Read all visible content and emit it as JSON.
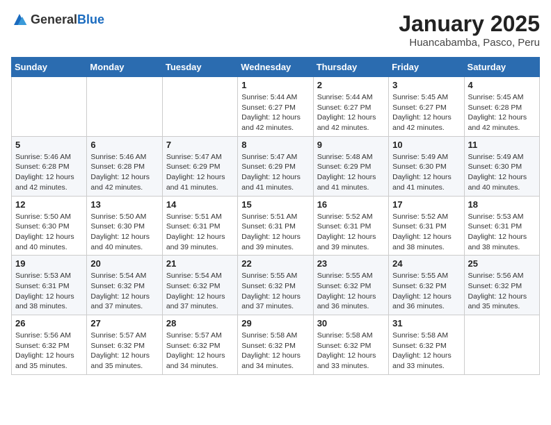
{
  "logo": {
    "general": "General",
    "blue": "Blue"
  },
  "header": {
    "title": "January 2025",
    "subtitle": "Huancabamba, Pasco, Peru"
  },
  "weekdays": [
    "Sunday",
    "Monday",
    "Tuesday",
    "Wednesday",
    "Thursday",
    "Friday",
    "Saturday"
  ],
  "weeks": [
    [
      {
        "day": "",
        "info": ""
      },
      {
        "day": "",
        "info": ""
      },
      {
        "day": "",
        "info": ""
      },
      {
        "day": "1",
        "info": "Sunrise: 5:44 AM\nSunset: 6:27 PM\nDaylight: 12 hours and 42 minutes."
      },
      {
        "day": "2",
        "info": "Sunrise: 5:44 AM\nSunset: 6:27 PM\nDaylight: 12 hours and 42 minutes."
      },
      {
        "day": "3",
        "info": "Sunrise: 5:45 AM\nSunset: 6:27 PM\nDaylight: 12 hours and 42 minutes."
      },
      {
        "day": "4",
        "info": "Sunrise: 5:45 AM\nSunset: 6:28 PM\nDaylight: 12 hours and 42 minutes."
      }
    ],
    [
      {
        "day": "5",
        "info": "Sunrise: 5:46 AM\nSunset: 6:28 PM\nDaylight: 12 hours and 42 minutes."
      },
      {
        "day": "6",
        "info": "Sunrise: 5:46 AM\nSunset: 6:28 PM\nDaylight: 12 hours and 42 minutes."
      },
      {
        "day": "7",
        "info": "Sunrise: 5:47 AM\nSunset: 6:29 PM\nDaylight: 12 hours and 41 minutes."
      },
      {
        "day": "8",
        "info": "Sunrise: 5:47 AM\nSunset: 6:29 PM\nDaylight: 12 hours and 41 minutes."
      },
      {
        "day": "9",
        "info": "Sunrise: 5:48 AM\nSunset: 6:29 PM\nDaylight: 12 hours and 41 minutes."
      },
      {
        "day": "10",
        "info": "Sunrise: 5:49 AM\nSunset: 6:30 PM\nDaylight: 12 hours and 41 minutes."
      },
      {
        "day": "11",
        "info": "Sunrise: 5:49 AM\nSunset: 6:30 PM\nDaylight: 12 hours and 40 minutes."
      }
    ],
    [
      {
        "day": "12",
        "info": "Sunrise: 5:50 AM\nSunset: 6:30 PM\nDaylight: 12 hours and 40 minutes."
      },
      {
        "day": "13",
        "info": "Sunrise: 5:50 AM\nSunset: 6:30 PM\nDaylight: 12 hours and 40 minutes."
      },
      {
        "day": "14",
        "info": "Sunrise: 5:51 AM\nSunset: 6:31 PM\nDaylight: 12 hours and 39 minutes."
      },
      {
        "day": "15",
        "info": "Sunrise: 5:51 AM\nSunset: 6:31 PM\nDaylight: 12 hours and 39 minutes."
      },
      {
        "day": "16",
        "info": "Sunrise: 5:52 AM\nSunset: 6:31 PM\nDaylight: 12 hours and 39 minutes."
      },
      {
        "day": "17",
        "info": "Sunrise: 5:52 AM\nSunset: 6:31 PM\nDaylight: 12 hours and 38 minutes."
      },
      {
        "day": "18",
        "info": "Sunrise: 5:53 AM\nSunset: 6:31 PM\nDaylight: 12 hours and 38 minutes."
      }
    ],
    [
      {
        "day": "19",
        "info": "Sunrise: 5:53 AM\nSunset: 6:31 PM\nDaylight: 12 hours and 38 minutes."
      },
      {
        "day": "20",
        "info": "Sunrise: 5:54 AM\nSunset: 6:32 PM\nDaylight: 12 hours and 37 minutes."
      },
      {
        "day": "21",
        "info": "Sunrise: 5:54 AM\nSunset: 6:32 PM\nDaylight: 12 hours and 37 minutes."
      },
      {
        "day": "22",
        "info": "Sunrise: 5:55 AM\nSunset: 6:32 PM\nDaylight: 12 hours and 37 minutes."
      },
      {
        "day": "23",
        "info": "Sunrise: 5:55 AM\nSunset: 6:32 PM\nDaylight: 12 hours and 36 minutes."
      },
      {
        "day": "24",
        "info": "Sunrise: 5:55 AM\nSunset: 6:32 PM\nDaylight: 12 hours and 36 minutes."
      },
      {
        "day": "25",
        "info": "Sunrise: 5:56 AM\nSunset: 6:32 PM\nDaylight: 12 hours and 35 minutes."
      }
    ],
    [
      {
        "day": "26",
        "info": "Sunrise: 5:56 AM\nSunset: 6:32 PM\nDaylight: 12 hours and 35 minutes."
      },
      {
        "day": "27",
        "info": "Sunrise: 5:57 AM\nSunset: 6:32 PM\nDaylight: 12 hours and 35 minutes."
      },
      {
        "day": "28",
        "info": "Sunrise: 5:57 AM\nSunset: 6:32 PM\nDaylight: 12 hours and 34 minutes."
      },
      {
        "day": "29",
        "info": "Sunrise: 5:58 AM\nSunset: 6:32 PM\nDaylight: 12 hours and 34 minutes."
      },
      {
        "day": "30",
        "info": "Sunrise: 5:58 AM\nSunset: 6:32 PM\nDaylight: 12 hours and 33 minutes."
      },
      {
        "day": "31",
        "info": "Sunrise: 5:58 AM\nSunset: 6:32 PM\nDaylight: 12 hours and 33 minutes."
      },
      {
        "day": "",
        "info": ""
      }
    ]
  ]
}
